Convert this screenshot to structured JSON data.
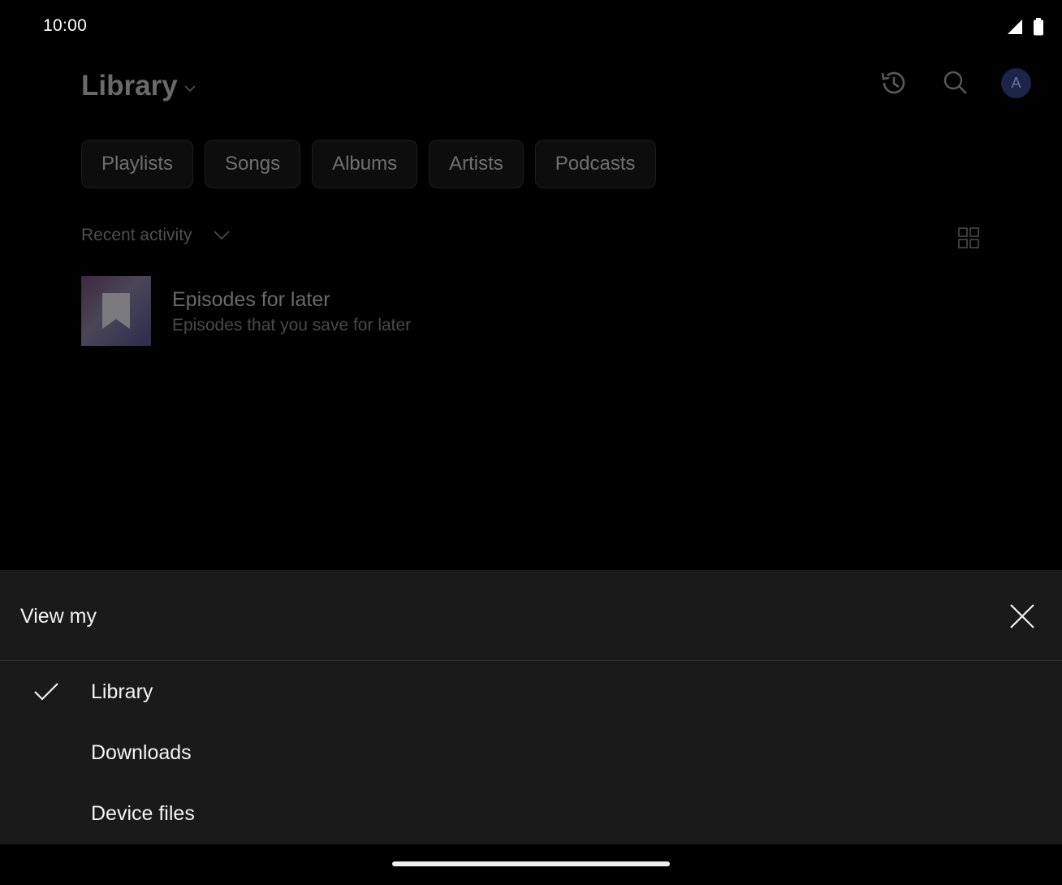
{
  "status_bar": {
    "time": "10:00",
    "icons": [
      "signal-icon",
      "battery-icon"
    ]
  },
  "header": {
    "title": "Library",
    "actions": [
      "history-icon",
      "search-icon"
    ],
    "avatar_letter": "A"
  },
  "chips": [
    "Playlists",
    "Songs",
    "Albums",
    "Artists",
    "Podcasts"
  ],
  "sort": {
    "label": "Recent activity"
  },
  "list_items": [
    {
      "title": "Episodes for later",
      "subtitle": "Episodes that you save for later",
      "icon": "bookmark-icon"
    }
  ],
  "sheet": {
    "title": "View my",
    "options": [
      {
        "label": "Library",
        "selected": true
      },
      {
        "label": "Downloads",
        "selected": false
      },
      {
        "label": "Device files",
        "selected": false
      }
    ]
  },
  "colors": {
    "background": "#000000",
    "sheet": "#1a1a1a",
    "avatar": "#1c2447",
    "text_primary": "#f2f2f2",
    "text_dimmed": "#6a6a6a"
  }
}
